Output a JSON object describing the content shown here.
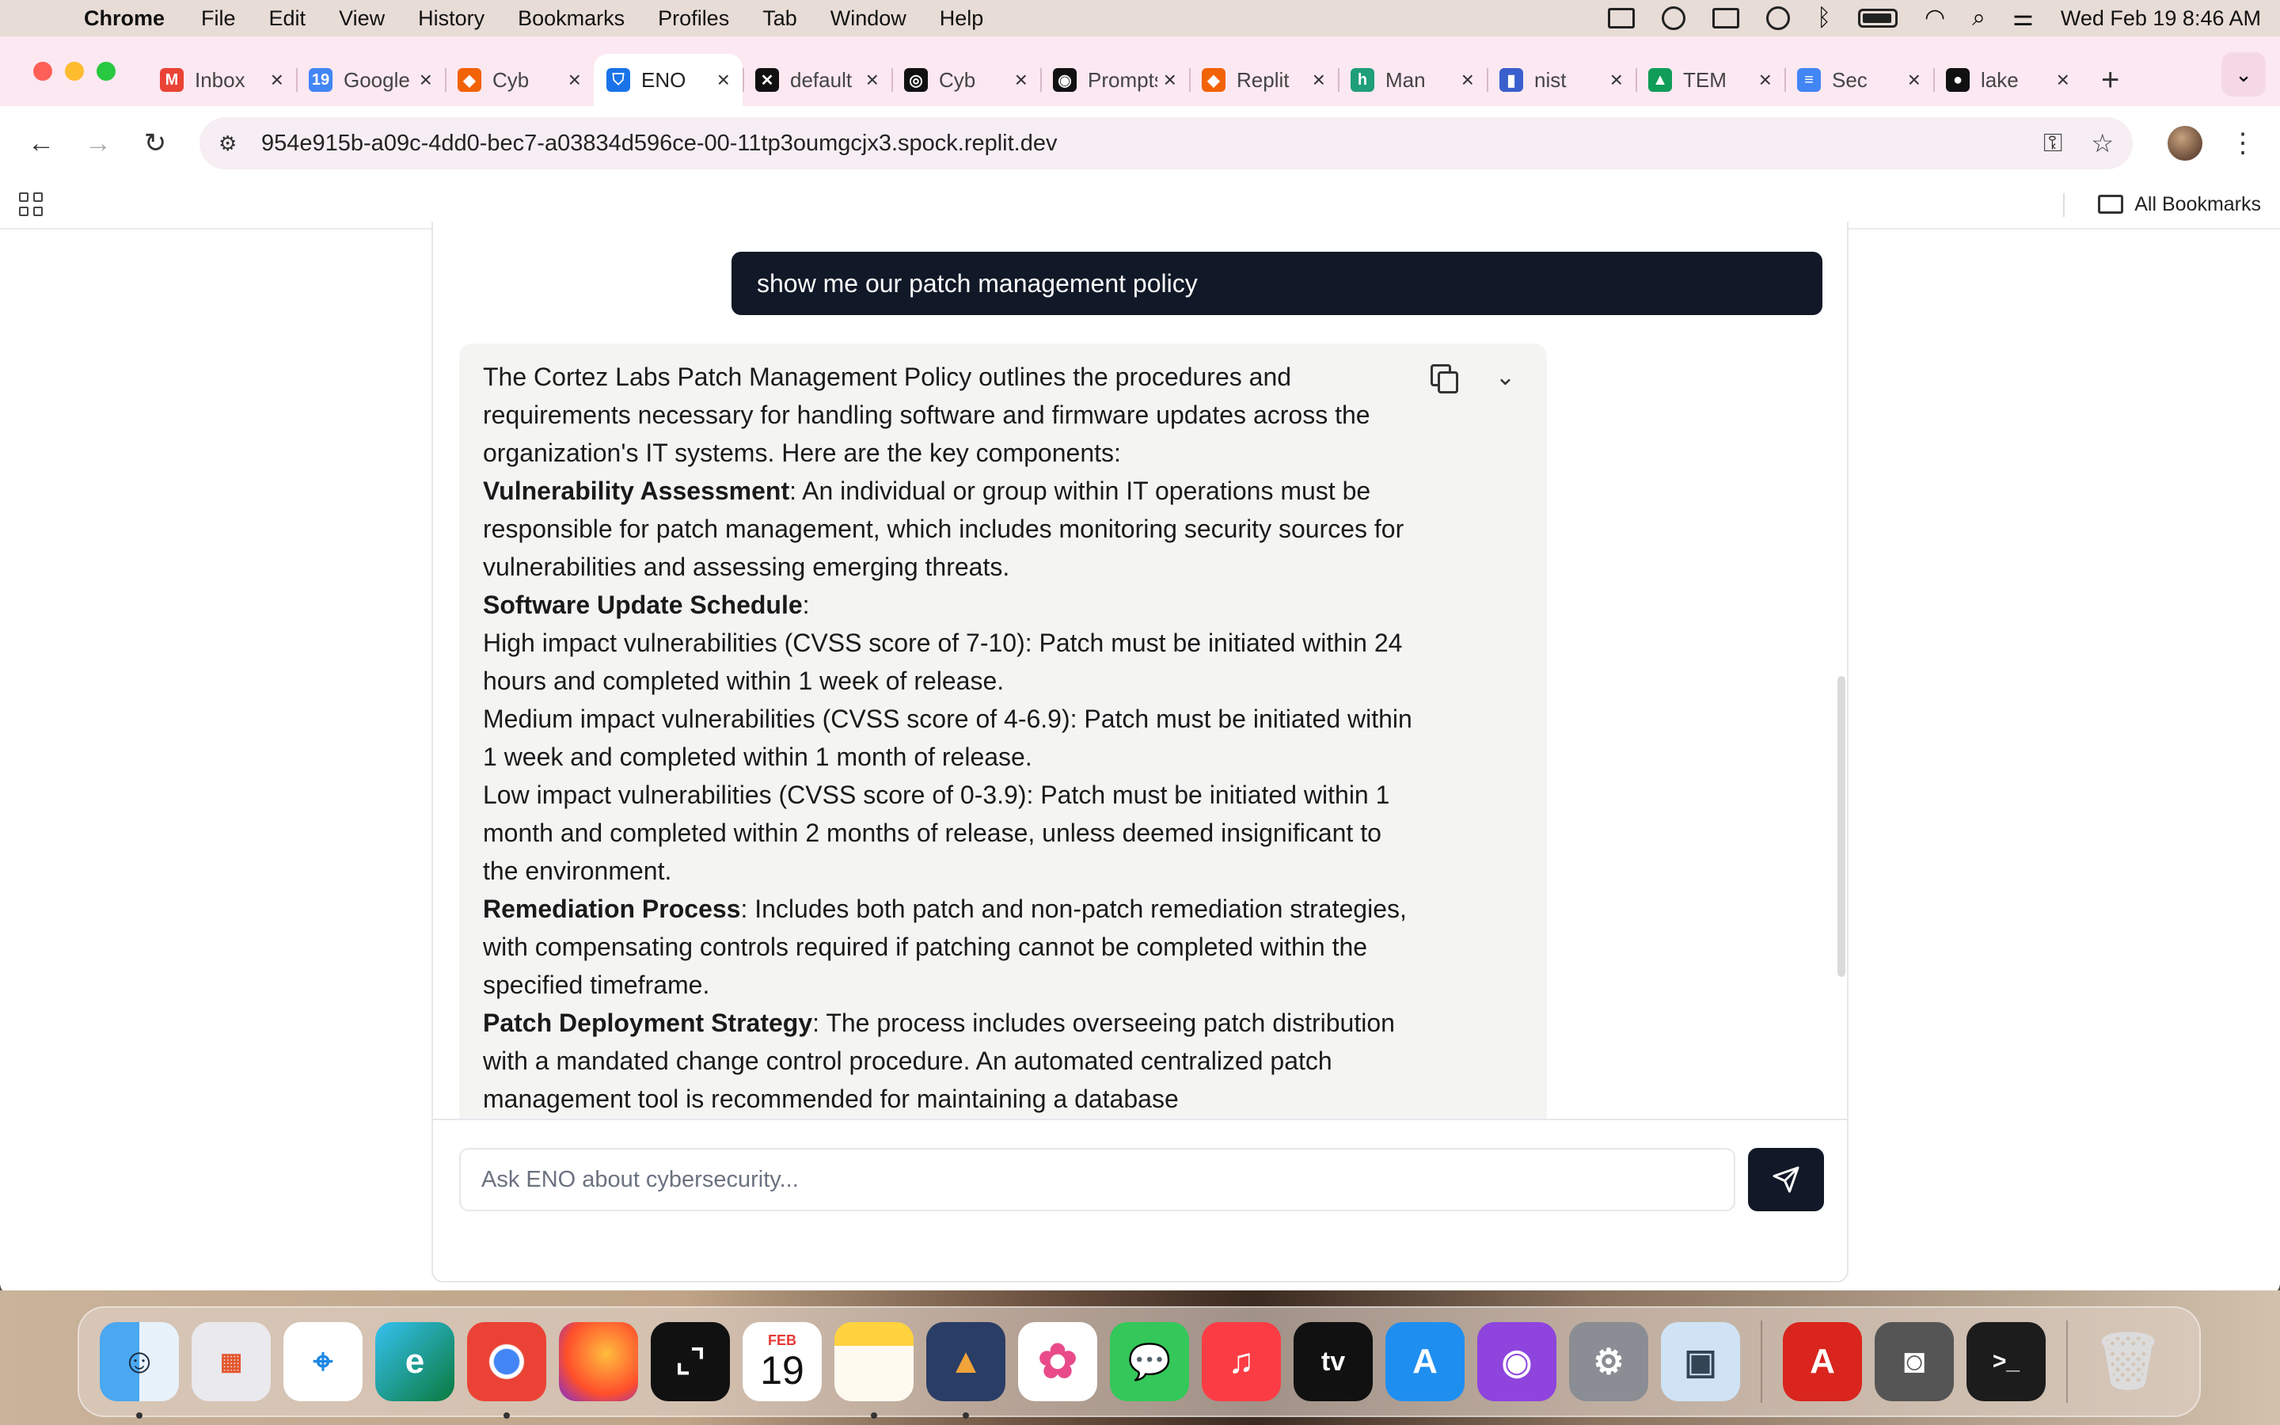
{
  "menubar": {
    "app_name": "Chrome",
    "items": [
      "File",
      "Edit",
      "View",
      "History",
      "Bookmarks",
      "Profiles",
      "Tab",
      "Window",
      "Help"
    ],
    "clock": "Wed Feb 19  8:46 AM"
  },
  "tabs": [
    {
      "title": "Inbox",
      "favicon_text": "M",
      "favicon_color": "#ea4335",
      "active": false
    },
    {
      "title": "Google Calendar",
      "favicon_text": "19",
      "favicon_color": "#4285f4",
      "active": false
    },
    {
      "title": "Cyb",
      "favicon_text": "◆",
      "favicon_color": "#f26207",
      "active": false
    },
    {
      "title": "ENO",
      "favicon_text": "⛉",
      "favicon_color": "#1a73e8",
      "active": true
    },
    {
      "title": "default",
      "favicon_text": "✕",
      "favicon_color": "#111111",
      "active": false
    },
    {
      "title": "Cyb",
      "favicon_text": "◎",
      "favicon_color": "#111111",
      "active": false
    },
    {
      "title": "Prompts",
      "favicon_text": "◉",
      "favicon_color": "#111111",
      "active": false
    },
    {
      "title": "Replit",
      "favicon_text": "◆",
      "favicon_color": "#f26207",
      "active": false
    },
    {
      "title": "Man",
      "favicon_text": "h",
      "favicon_color": "#1f9e7a",
      "active": false
    },
    {
      "title": "nist",
      "favicon_text": "▮",
      "favicon_color": "#3a5fcd",
      "active": false
    },
    {
      "title": "TEM",
      "favicon_text": "▲",
      "favicon_color": "#0f9d58",
      "active": false
    },
    {
      "title": "Sec",
      "favicon_text": "≡",
      "favicon_color": "#4285f4",
      "active": false
    },
    {
      "title": "lake",
      "favicon_text": "●",
      "favicon_color": "#111111",
      "active": false
    }
  ],
  "toolbar": {
    "url": "954e915b-a09c-4dd0-bec7-a03834d596ce-00-11tp3oumgcjx3.spock.replit.dev"
  },
  "bookmarks": {
    "all_label": "All Bookmarks"
  },
  "chat": {
    "user_message": "show me our patch management policy",
    "bot_intro": "The Cortez Labs Patch Management Policy outlines the procedures and requirements necessary for handling software and firmware updates across the organization's IT systems. Here are the key components:",
    "sections": {
      "vuln_title": "Vulnerability Assessment",
      "vuln_body": ": An individual or group within IT operations must be responsible for patch management, which includes monitoring security sources for vulnerabilities and assessing emerging threats.",
      "schedule_title": "Software Update Schedule",
      "schedule_colon": ":",
      "high": "High impact vulnerabilities (CVSS score of 7-10): Patch must be initiated within 24 hours and completed within 1 week of release.",
      "medium": "Medium impact vulnerabilities (CVSS score of 4-6.9): Patch must be initiated within 1 week and completed within 1 month of release.",
      "low": "Low impact vulnerabilities (CVSS score of 0-3.9): Patch must be initiated within 1 month and completed within 2 months of release, unless deemed insignificant to the environment.",
      "remediation_title": "Remediation Process",
      "remediation_body": ": Includes both patch and non-patch remediation strategies, with compensating controls required if patching cannot be completed within the specified timeframe.",
      "deployment_title": "Patch Deployment Strategy",
      "deployment_body": ": The process includes overseeing patch distribution with a mandated change control procedure. An automated centralized patch management tool is recommended for maintaining a database"
    },
    "input_placeholder": "Ask ENO about cybersecurity..."
  },
  "dock": {
    "calendar_month": "FEB",
    "calendar_day": "19",
    "apps": [
      "finder",
      "launchpad",
      "safari",
      "edge",
      "chrome",
      "firefox",
      "screenshot",
      "calendar",
      "notes",
      "tailscale",
      "photos",
      "messages",
      "music",
      "tv",
      "app-store",
      "podcasts",
      "system-settings",
      "preview",
      "acrobat",
      "image-capture",
      "terminal",
      "trash"
    ]
  }
}
